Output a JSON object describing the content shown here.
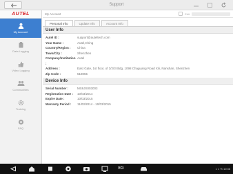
{
  "topbar": {
    "title": "Support"
  },
  "brand": {
    "name": "AUTEL"
  },
  "sidebar": {
    "items": [
      {
        "label": "My Account",
        "icon": "user-icon",
        "active": true
      },
      {
        "label": "Data Logging",
        "icon": "clipboard-icon",
        "active": false
      },
      {
        "label": "Video Logging",
        "icon": "thumbs-up-icon",
        "active": false
      },
      {
        "label": "Communities",
        "icon": "people-icon",
        "active": false
      },
      {
        "label": "Training",
        "icon": "gear-icon",
        "active": false
      },
      {
        "label": "FAQ",
        "icon": "help-icon",
        "active": false
      }
    ]
  },
  "main": {
    "breadcrumb": "My Account",
    "action_hint": "Edit",
    "tabs": [
      {
        "label": "Personal Info",
        "active": true
      },
      {
        "label": "Update Info",
        "active": false
      },
      {
        "label": "Account Info",
        "active": false
      }
    ],
    "user_info": {
      "title": "User Info",
      "rows": [
        {
          "key": "Autel ID :",
          "value": "support@auteltech.com"
        },
        {
          "key": "Your Name :",
          "value": "Autel,Ching"
        },
        {
          "key": "Country/Region :",
          "value": "China"
        },
        {
          "key": "Town/City :",
          "value": "Shenzhen"
        },
        {
          "key": "Company/Institution :",
          "value": "Autel"
        },
        {
          "key": "Address :",
          "value": "East Gate, 1st floor, of 3/2/3 Bldg, 1098 Chaguang Road Xili, Nanshan, Shenzhen"
        },
        {
          "key": "Zip Code :",
          "value": "518055"
        }
      ]
    },
    "device_info": {
      "title": "Device Info",
      "rows": [
        {
          "key": "Serial Number :",
          "value": "MS9JS003003"
        },
        {
          "key": "Registration Date :",
          "value": "10/03/2014"
        },
        {
          "key": "Expire Date :",
          "value": "10/03/2015"
        },
        {
          "key": "Warranty Period :",
          "value": "11/03/2014 - 10/03/2015"
        }
      ]
    }
  },
  "navbar": {
    "vci_label": "VCI",
    "status": "1 1 % 10:36"
  },
  "colors": {
    "accent": "#3d7fd0",
    "brand": "#d71920",
    "navbar": "#111111"
  }
}
